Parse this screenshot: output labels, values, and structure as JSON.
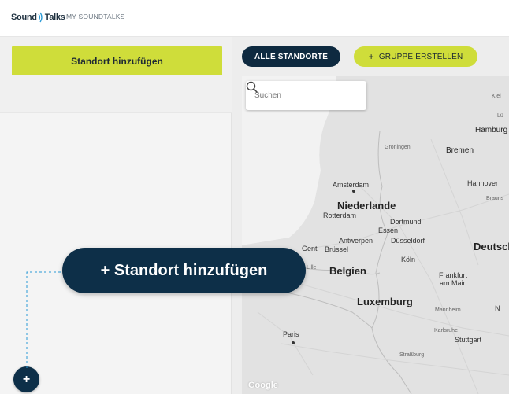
{
  "header": {
    "logo_part1": "Sound",
    "logo_part2": "Talks",
    "nav_link": "MY SOUNDTALKS"
  },
  "sidebar": {
    "add_location_label": "Standort hinzufügen",
    "fab_label": "+"
  },
  "toolbar": {
    "all_locations_label": "ALLE STANDORTE",
    "create_group_plus": "+",
    "create_group_label": "GRUPPE ERSTELLEN"
  },
  "map": {
    "search_placeholder": "Suchen",
    "attribution": "Google",
    "places": {
      "kiel": "Kiel",
      "lu": "Lü",
      "hamburg": "Hamburg",
      "groningen": "Groningen",
      "bremen": "Bremen",
      "amsterdam": "Amsterdam",
      "hannover": "Hannover",
      "brauns": "Brauns",
      "niederlande": "Niederlande",
      "rotterdam": "Rotterdam",
      "dortmund": "Dortmund",
      "essen": "Essen",
      "antwerpen": "Antwerpen",
      "dusseldorf": "Düsseldorf",
      "gent": "Gent",
      "brussel": "Brüssel",
      "deutschland": "Deutsch",
      "koln": "Köln",
      "lille": "Lille",
      "belgien": "Belgien",
      "frankfurt": "Frankfurt",
      "am_main": "am Main",
      "luxemburg": "Luxemburg",
      "mannheim": "Mannheim",
      "n": "N",
      "paris": "Paris",
      "karlsruhe": "Karlsruhe",
      "stuttgart": "Stuttgart",
      "strasbourg": "Straßburg"
    }
  },
  "tooltip": {
    "label": "+ Standort hinzufügen"
  },
  "colors": {
    "accent_lime": "#cfdd3a",
    "navy": "#0d2f48",
    "connector": "#2a9ad6"
  }
}
